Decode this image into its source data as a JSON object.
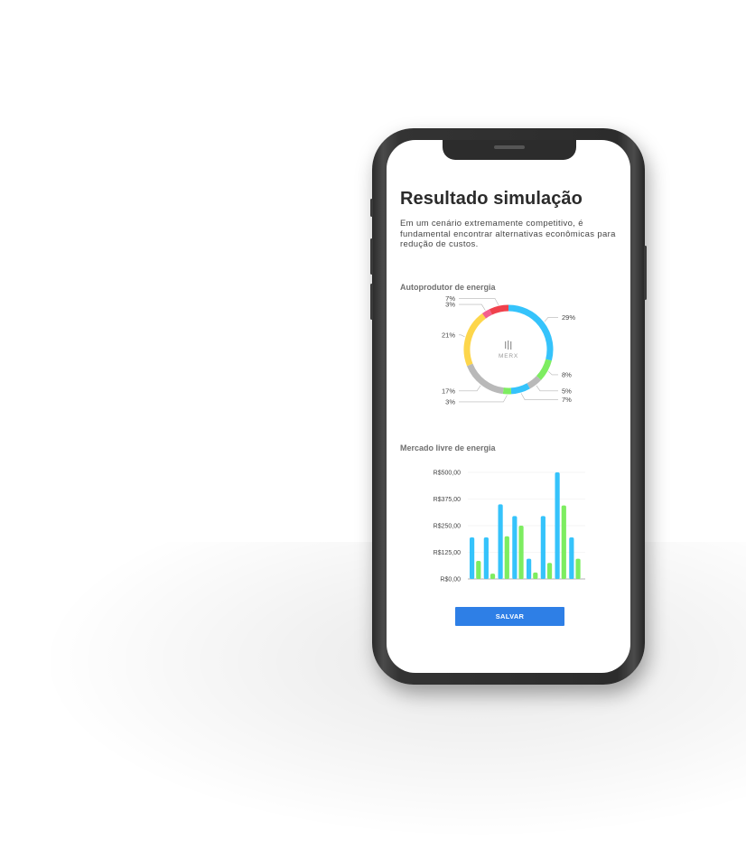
{
  "screen": {
    "title": "Resultado simulação",
    "description": "Em um cenário extremamente competitivo, é fundamental encontrar alternativas econômicas para redução de custos.",
    "section1_label": "Autoprodutor de energia",
    "section2_label": "Mercado livre de energia",
    "save_label": "SALVAR",
    "logo_text": "MERX"
  },
  "colors": {
    "blue": "#35c3fb",
    "green": "#7ded60",
    "gray": "#b9b9b9",
    "red": "#f0414c",
    "pink": "#f35f8e",
    "yellow": "#fdd64b",
    "button": "#2e7fe6"
  },
  "chart_data": [
    {
      "type": "pie",
      "variant": "donut",
      "center_logo": "MERX",
      "slices": [
        {
          "label": "29%",
          "value": 29,
          "color": "#35c3fb"
        },
        {
          "label": "8%",
          "value": 8,
          "color": "#7ded60"
        },
        {
          "label": "5%",
          "value": 5,
          "color": "#b9b9b9"
        },
        {
          "label": "7%",
          "value": 7,
          "color": "#35c3fb"
        },
        {
          "label": "3%",
          "value": 3,
          "color": "#7ded60"
        },
        {
          "label": "17%",
          "value": 17,
          "color": "#b9b9b9"
        },
        {
          "label": "21%",
          "value": 21,
          "color": "#fdd64b"
        },
        {
          "label": "3%",
          "value": 3,
          "color": "#f35f8e"
        },
        {
          "label": "7%",
          "value": 7,
          "color": "#f0414c"
        }
      ]
    },
    {
      "type": "bar",
      "ylim": [
        0,
        500
      ],
      "y_ticks": [
        "R$0,00",
        "R$125,00",
        "R$250,00",
        "R$375,00",
        "R$500,00"
      ],
      "y_tick_values": [
        0,
        125,
        250,
        375,
        500
      ],
      "categories": [
        "",
        "",
        "",
        "",
        "",
        "",
        "",
        ""
      ],
      "series": [
        {
          "color": "#35c3fb",
          "values": [
            195,
            195,
            350,
            295,
            95,
            295,
            500,
            195
          ]
        },
        {
          "color": "#7ded60",
          "values": [
            85,
            25,
            200,
            250,
            30,
            75,
            345,
            95
          ]
        }
      ]
    }
  ]
}
